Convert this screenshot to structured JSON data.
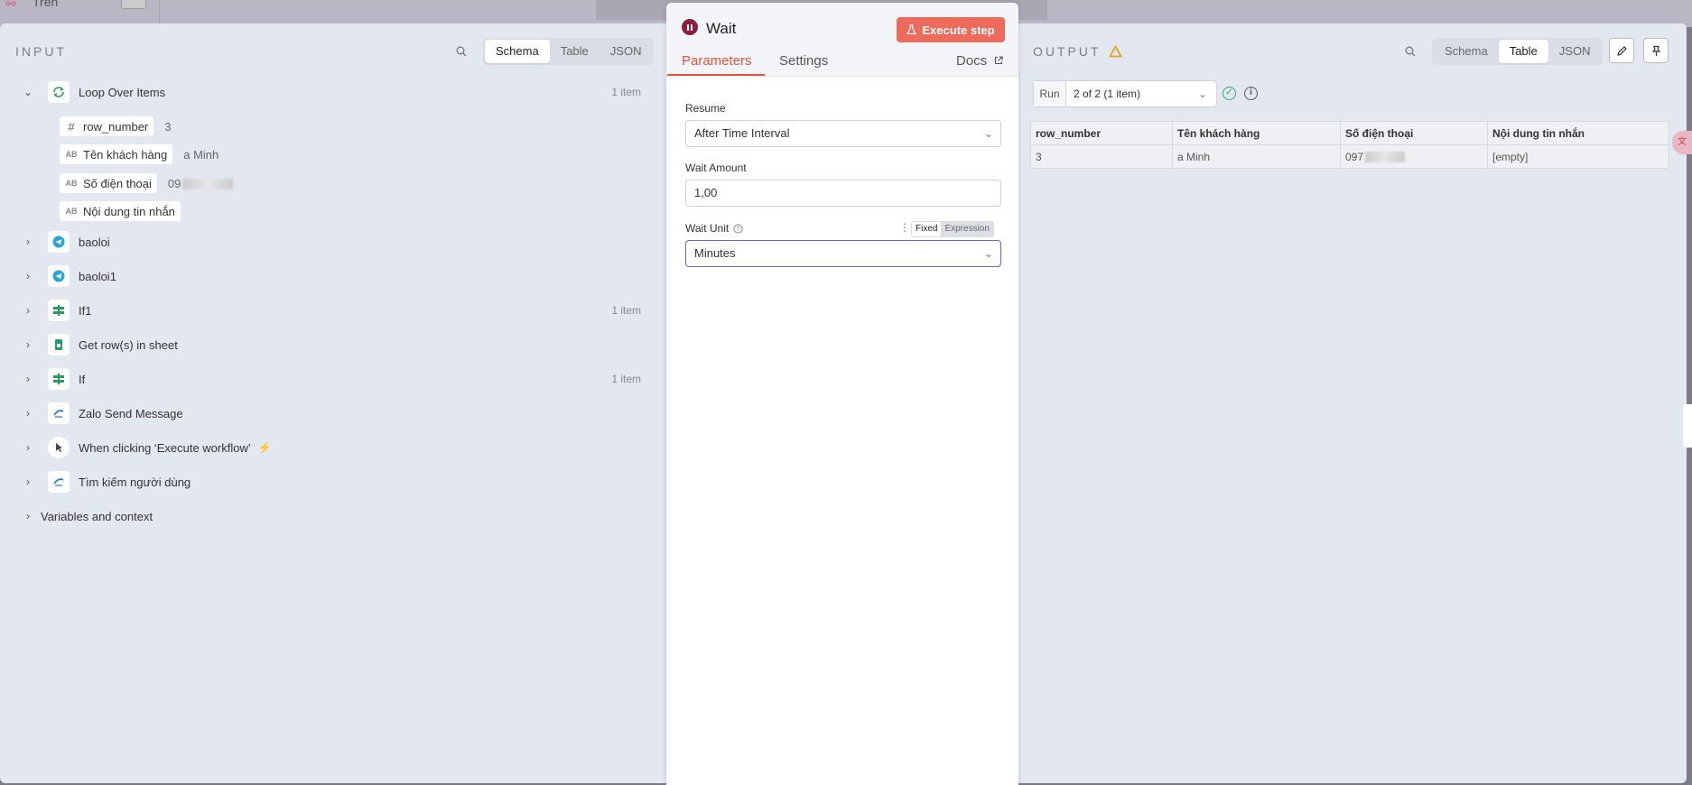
{
  "backdrop": {
    "workflow_name": "Trên"
  },
  "input": {
    "title": "INPUT",
    "view_tabs": [
      "Schema",
      "Table",
      "JSON"
    ],
    "active_view": "Schema",
    "nodes": [
      {
        "label": "Loop Over Items",
        "count": "1 item",
        "icon": "loop-icon",
        "expanded": true
      },
      {
        "label": "baoloi",
        "count": "",
        "icon": "telegram-icon"
      },
      {
        "label": "baoloi1",
        "count": "",
        "icon": "telegram-icon"
      },
      {
        "label": "If1",
        "count": "1 item",
        "icon": "if-icon"
      },
      {
        "label": "Get row(s) in sheet",
        "count": "",
        "icon": "sheets-icon"
      },
      {
        "label": "If",
        "count": "1 item",
        "icon": "if-icon"
      },
      {
        "label": "Zalo Send Message",
        "count": "",
        "icon": "zalo-icon"
      },
      {
        "label": "When clicking ‘Execute workflow’",
        "count": "",
        "icon": "cursor-icon"
      },
      {
        "label": "Tìm kiếm người dùng",
        "count": "",
        "icon": "zalo-icon"
      }
    ],
    "fields": [
      {
        "type": "#",
        "name": "row_number",
        "value": "3"
      },
      {
        "type": "AB",
        "name": "Tên khách hàng",
        "value": "a Minh"
      },
      {
        "type": "AB",
        "name": "Số điện thoại",
        "value": "09"
      },
      {
        "type": "AB",
        "name": "Nội dung tin nhắn",
        "value": ""
      }
    ],
    "variables_label": "Variables and context"
  },
  "node": {
    "title": "Wait",
    "execute_label": "Execute step",
    "tabs": [
      "Parameters",
      "Settings"
    ],
    "active_tab": "Parameters",
    "docs_label": "Docs",
    "resume_label": "Resume",
    "resume_value": "After Time Interval",
    "amount_label": "Wait Amount",
    "amount_value": "1,00",
    "unit_label": "Wait Unit",
    "unit_value": "Minutes",
    "mode_fixed": "Fixed",
    "mode_expression": "Expression"
  },
  "output": {
    "title": "OUTPUT",
    "view_tabs": [
      "Schema",
      "Table",
      "JSON"
    ],
    "active_view": "Table",
    "run_label": "Run",
    "run_value": "2 of 2 (1 item)",
    "columns": [
      "row_number",
      "Tên khách hàng",
      "Số điện thoại",
      "Nội dung tin nhắn"
    ],
    "rows": [
      [
        "3",
        "a Minh",
        "097",
        "[empty]"
      ]
    ]
  },
  "colors": {
    "accent": "#e3533b",
    "execute": "#ee6a5a",
    "wait_icon": "#8c1f3e",
    "success": "#2ea87a",
    "empty": "#d9364e"
  }
}
